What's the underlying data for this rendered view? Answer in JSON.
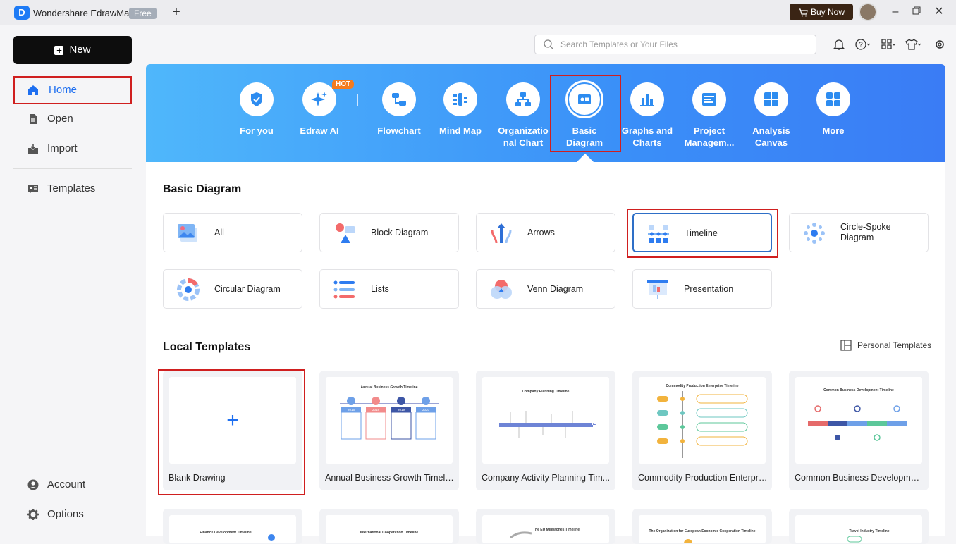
{
  "titlebar": {
    "app_name": "Wondershare EdrawMax",
    "badge": "Free",
    "buy_now": "Buy Now"
  },
  "sidebar": {
    "new_label": "New",
    "items": [
      {
        "label": "Home",
        "icon": "home-icon"
      },
      {
        "label": "Open",
        "icon": "file-icon"
      },
      {
        "label": "Import",
        "icon": "import-icon"
      },
      {
        "label": "Templates",
        "icon": "templates-icon"
      }
    ],
    "bottom": [
      {
        "label": "Account",
        "icon": "account-icon"
      },
      {
        "label": "Options",
        "icon": "gear-icon"
      }
    ]
  },
  "search": {
    "placeholder": "Search Templates or Your Files"
  },
  "banner": {
    "hot": "HOT",
    "categories": [
      {
        "label": "For you"
      },
      {
        "label": "Edraw AI"
      },
      {
        "label": "Flowchart"
      },
      {
        "label": "Mind Map"
      },
      {
        "label": "Organizatio nal Chart"
      },
      {
        "label": "Basic Diagram"
      },
      {
        "label": "Graphs and Charts"
      },
      {
        "label": "Project Managem..."
      },
      {
        "label": "Analysis Canvas"
      },
      {
        "label": "More"
      }
    ]
  },
  "basic_diagram": {
    "title": "Basic Diagram",
    "types": [
      {
        "label": "All"
      },
      {
        "label": "Block Diagram"
      },
      {
        "label": "Arrows"
      },
      {
        "label": "Timeline"
      },
      {
        "label": "Circle-Spoke Diagram"
      },
      {
        "label": "Circular Diagram"
      },
      {
        "label": "Lists"
      },
      {
        "label": "Venn Diagram"
      },
      {
        "label": "Presentation"
      }
    ]
  },
  "local_templates": {
    "title": "Local Templates",
    "personal_link": "Personal Templates",
    "cards": [
      {
        "label": "Blank Drawing"
      },
      {
        "label": "Annual Business Growth Timeline",
        "thumb_title": "Annual Business Growth Timeline",
        "thumb_years": [
          "2016",
          "2018",
          "2019",
          "2020"
        ]
      },
      {
        "label": "Company Activity Planning Tim...",
        "thumb_title": "Company Planning Timeline"
      },
      {
        "label": "Commodity Production Enterpri...",
        "thumb_title": "Commodity Production Enterprise Timeline"
      },
      {
        "label": "Common Business Developmen...",
        "thumb_title": "Common Business Development Timeline"
      }
    ],
    "row2_titles": [
      "Finance Development Timeline",
      "International Cooperation Timeline",
      "The EU Milestones Timeline",
      "The Organization for European Economic Cooperation Timeline",
      "Travel Industry Timeline"
    ]
  },
  "colors": {
    "accent": "#1e6ff0",
    "highlight": "#d01f1f",
    "banner_start": "#4fb7fb",
    "banner_end": "#3a7cf5"
  }
}
